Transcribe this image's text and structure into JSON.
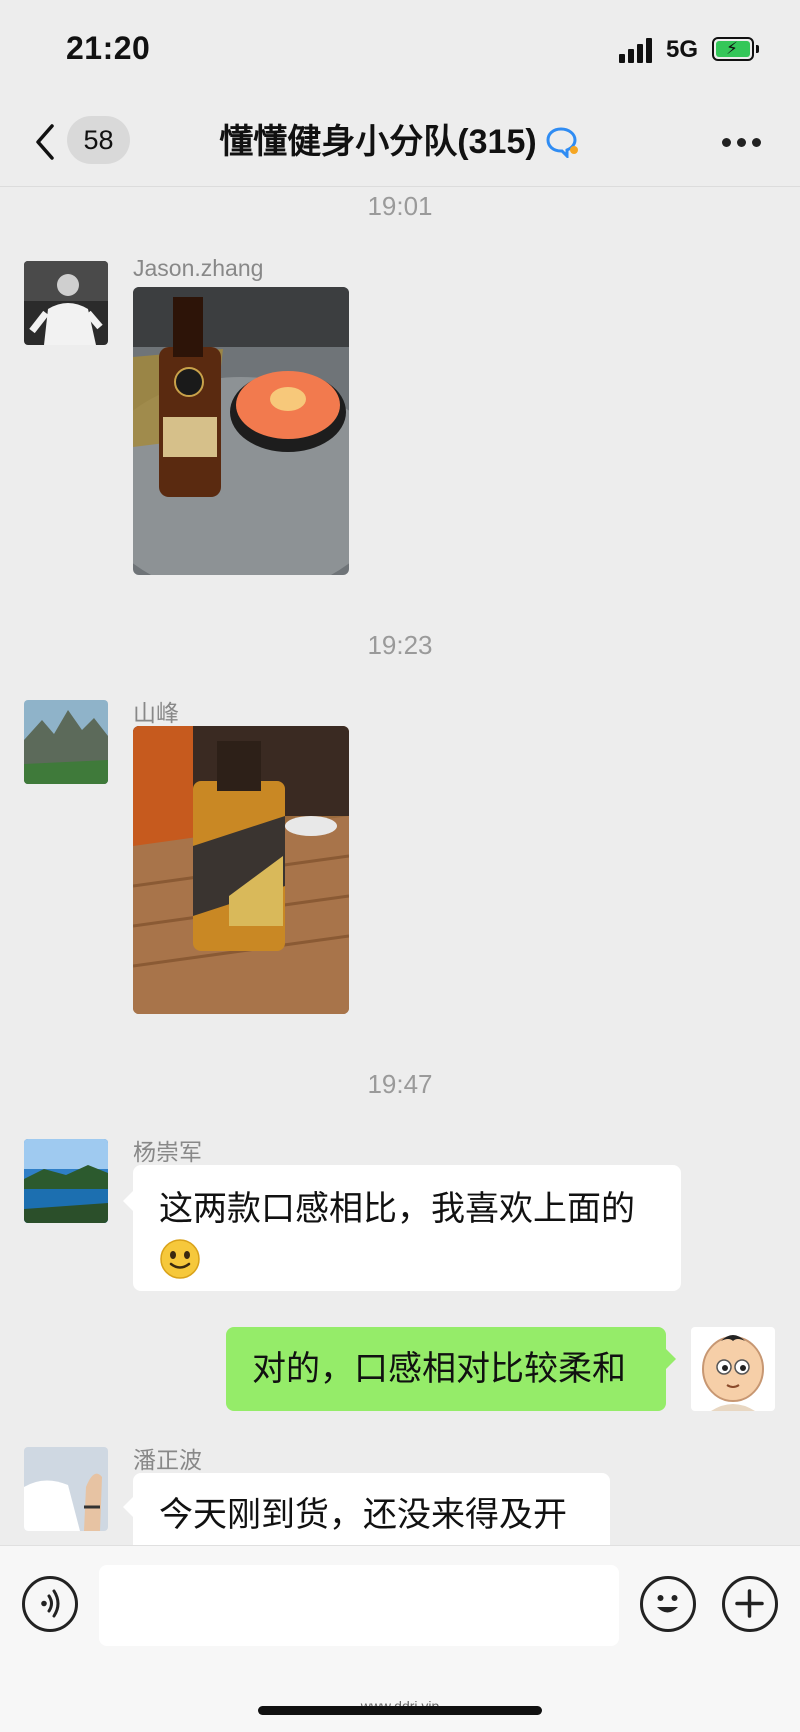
{
  "status_bar": {
    "time": "21:20",
    "network": "5G",
    "battery_icon": "battery-charging-icon",
    "battery_color": "#34c759"
  },
  "nav": {
    "back_count": "58",
    "title": "懂懂健身小分队(315)",
    "title_icon": "chat-bubble-icon",
    "more_icon": "more-dots-icon"
  },
  "messages": [
    {
      "type": "time",
      "text": "19:01"
    },
    {
      "type": "image",
      "sender": "Jason.zhang",
      "content": "whiskey-bottle-with-salmon-sashimi-photo"
    },
    {
      "type": "time",
      "text": "19:23"
    },
    {
      "type": "image",
      "sender": "山峰",
      "content": "whiskey-bottle-on-wooden-table-photo"
    },
    {
      "type": "time",
      "text": "19:47"
    },
    {
      "type": "text",
      "sender": "杨崇军",
      "text": "这两款口感相比，我喜欢上面的",
      "emoji": "smile-emoji"
    },
    {
      "type": "text",
      "sender": "self",
      "text": "对的，口感相对比较柔和"
    },
    {
      "type": "text",
      "sender": "潘正波",
      "text": "今天刚到货，还没来得及开"
    }
  ],
  "input_bar": {
    "placeholder": "",
    "voice_icon": "voice-icon",
    "emoji_icon": "emoji-icon",
    "plus_icon": "plus-icon"
  },
  "watermark": "www.ddrj.vip",
  "colors": {
    "background": "#ededed",
    "outgoing_bubble": "#95ec69",
    "incoming_bubble": "#ffffff",
    "chat_icon_blue": "#2f8cf3"
  }
}
